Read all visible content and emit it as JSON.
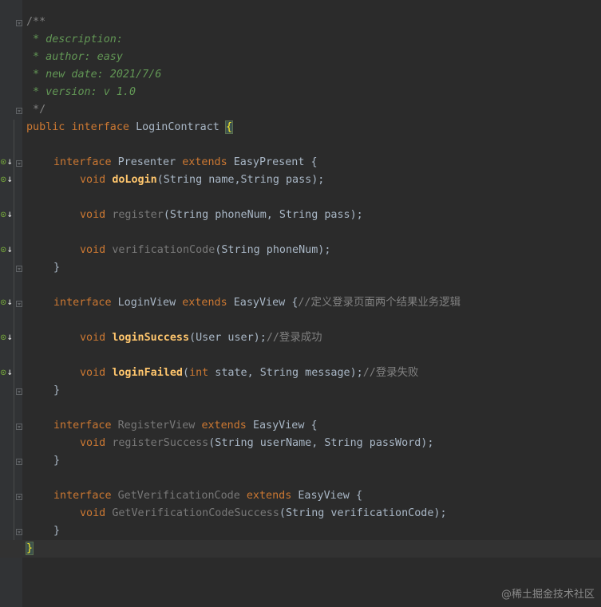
{
  "code": {
    "doc_open": "/**",
    "doc_description": " * description:",
    "doc_author": " * author: easy",
    "doc_new_date": " * new date: 2021/7/6",
    "doc_version": " * version: v 1.0",
    "doc_close": " */",
    "kw_public": "public",
    "kw_interface": "interface",
    "kw_extends": "extends",
    "kw_void": "void",
    "kw_int": "int",
    "class_name": "LoginContract",
    "presenter_name": "Presenter",
    "easy_present": "EasyPresent",
    "do_login": "doLogin",
    "do_login_params": "(String name,String pass);",
    "register": "register",
    "register_params": "(String phoneNum, String pass);",
    "verification_code": "verificationCode",
    "verification_code_params": "(String phoneNum);",
    "login_view_name": "LoginView",
    "easy_view": "EasyView",
    "login_view_comment": "//定义登录页面两个结果业务逻辑",
    "login_success": "loginSuccess",
    "login_success_params": "(User user);",
    "login_success_comment": "//登录成功",
    "login_failed": "loginFailed",
    "login_failed_params_a": "(",
    "login_failed_params_b": " state, String message);",
    "login_failed_comment": "//登录失败",
    "register_view_name": "RegisterView",
    "register_success": "registerSuccess",
    "register_success_params": "(String userName, String passWord);",
    "get_verification_code_name": "GetVerificationCode",
    "get_verification_code_success": "GetVerificationCodeSuccess",
    "get_verification_code_success_params": "(String verificationCode);",
    "open_brace": "{",
    "close_brace": "}"
  },
  "gutter": {
    "impl_icon": "implemented-method-icon",
    "impl_glyph": "⊙",
    "impl_arrow": "↓"
  },
  "watermark": "@稀土掘金技术社区",
  "colors": {
    "background": "#2b2b2b",
    "keyword": "#cc7832",
    "doc_comment": "#629755",
    "method_decl": "#ffc66d",
    "default_text": "#a9b7c6"
  }
}
